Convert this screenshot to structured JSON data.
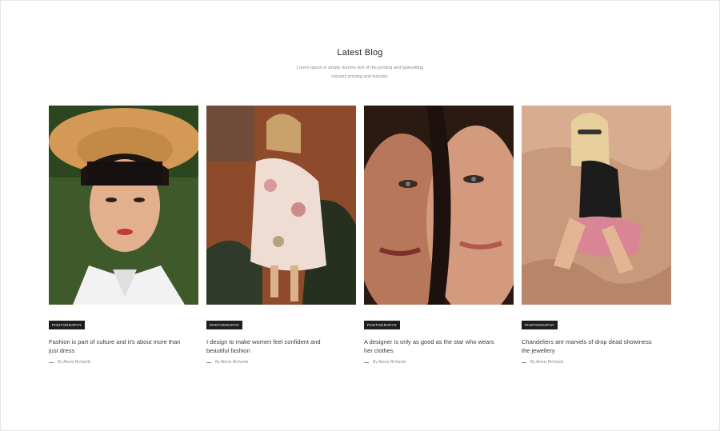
{
  "header": {
    "title": "Latest Blog",
    "subtitle": "Lorem Ipsum is simply dummy text of the printing and typesetting industry printing and industry."
  },
  "posts": [
    {
      "category": "Photography",
      "title": "Fashion is part of culture and it's about more than just dress",
      "author": "By Alexis Richards",
      "image": "portrait-woman-straw-hat"
    },
    {
      "category": "Photography",
      "title": "I design to make women feel confident and beautiful fashion",
      "author": "By Alexis Richards",
      "image": "woman-floral-dress"
    },
    {
      "category": "Photography",
      "title": "A designer is only as good as the star who wears her clothes",
      "author": "By Alexis Richards",
      "image": "two-women-faces"
    },
    {
      "category": "Photography",
      "title": "Chandeliers are marvels of drop dead showiness the jewellery",
      "author": "By Alexis Richards",
      "image": "woman-sitting-sand"
    }
  ]
}
